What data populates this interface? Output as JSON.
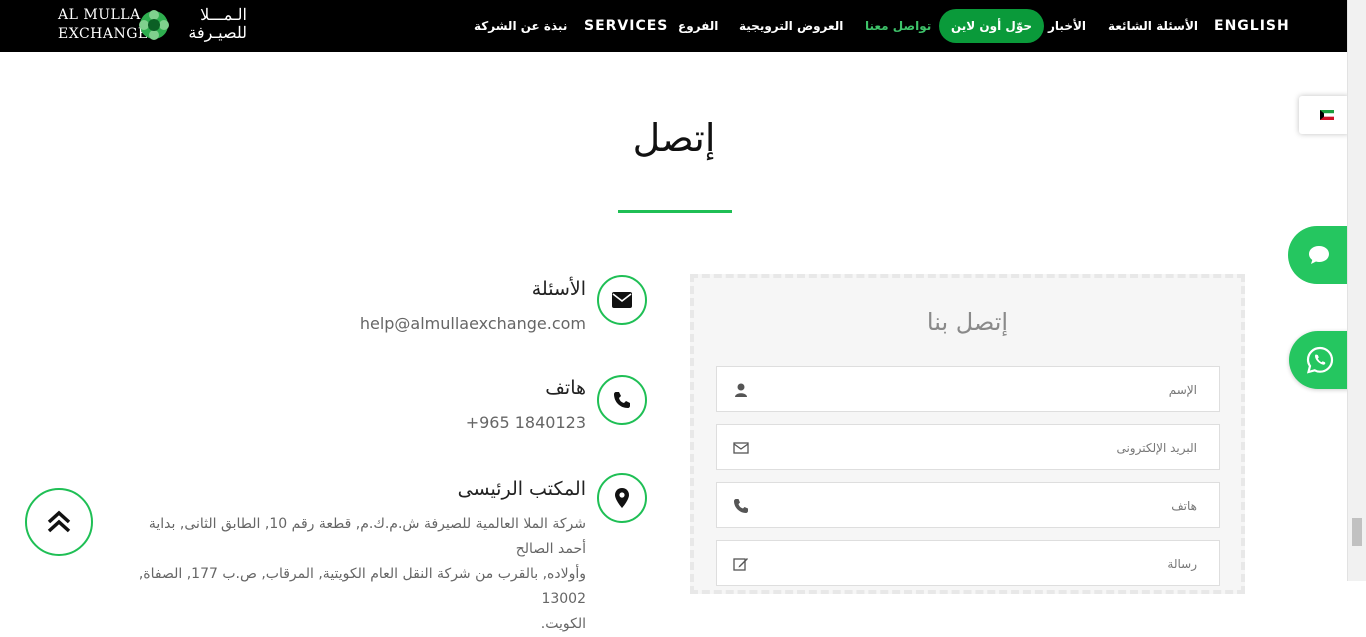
{
  "logo": {
    "text_en_line1": "AL MULLA",
    "text_en_line2": "EXCHANGE",
    "text_ar_line1": "الـمـــلا",
    "text_ar_line2": "للصيـرفة"
  },
  "nav": {
    "english": "ENGLISH",
    "faq": "الأسئلة الشائعة",
    "news": "الأخبار",
    "transfer_online": "حوّل أون لاين",
    "contact_us": "تواصل معنا",
    "promotions": "العروض الترويجية",
    "branches": "الفروع",
    "services": "SERVICES",
    "about": "نبذة عن الشركة"
  },
  "page": {
    "title": "إتصل"
  },
  "contact_info": {
    "email_title": "الأسئلة",
    "email_value": "help@almullaexchange.com",
    "phone_title": "هاتف",
    "phone_value": "+965 1840123",
    "office_title": "المكتب الرئيسى",
    "office_line1": "شركة الملا العالمية للصيرفة ش.م.ك.م, قطعة رقم 10, الطابق الثانى, بداية أحمد الصالح",
    "office_line2": "وأولاده, بالقرب من شركة النقل العام الكويتية, المرقاب, ص.ب 177, الصفاة, 13002",
    "office_line3": "الكويت."
  },
  "form": {
    "heading": "إتصل بنا",
    "name_placeholder": "الإسم",
    "email_placeholder": "البريد الإلكترونى",
    "phone_placeholder": "هاتف",
    "message_placeholder": "رسالة"
  },
  "icons": {
    "email": "envelope-icon",
    "phone": "phone-icon",
    "office": "map-marker-icon",
    "chat": "chat-bubble-icon",
    "whatsapp": "whatsapp-icon",
    "back_to_top": "double-chevron-up-icon",
    "flag": "kuwait-flag-icon"
  },
  "colors": {
    "accent": "#1fbf55",
    "nav_bg": "#000000",
    "pill": "#0a9a3a",
    "active_nav": "#3ec36a",
    "float": "#25c660"
  }
}
